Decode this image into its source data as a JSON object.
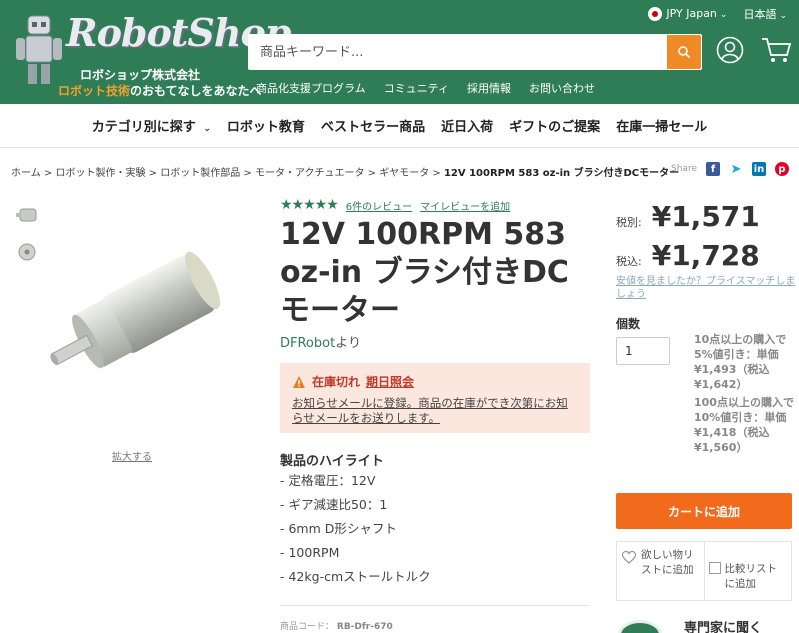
{
  "header": {
    "logo_text": "RobotShop",
    "logo_sub1": "ロボショップ株式会社",
    "logo_sub2_accent": "ロボット技術",
    "logo_sub2_rest": "のおもてなしをあなたへ",
    "currency": "JPY Japan",
    "language": "日本語",
    "search_placeholder": "商品キーワード...",
    "sublinks": [
      "商品化支援プログラム",
      "コミュニティ",
      "採用情報",
      "お問い合わせ"
    ]
  },
  "catnav": [
    "カテゴリ別に探す",
    "ロボット教育",
    "ベストセラー商品",
    "近日入荷",
    "ギフトのご提案",
    "在庫一掃セール"
  ],
  "breadcrumb": [
    "ホーム",
    "ロボット製作・実験",
    "ロボット製作部品",
    "モータ・アクチュエータ",
    "ギヤモータ"
  ],
  "breadcrumb_current": "12V 100RPM 583 oz-in ブラシ付きDCモーター",
  "share": {
    "label": "Share",
    "icons": [
      "facebook-icon",
      "twitter-icon",
      "linkedin-icon",
      "pinterest-icon"
    ]
  },
  "gallery": {
    "zoom_label": "拡大する"
  },
  "product": {
    "reviews_link": "6件のレビュー",
    "add_review_link": "マイレビューを追加",
    "rating": 4.5,
    "title": "12V 100RPM 583 oz-in ブラシ付きDCモーター",
    "brand_link": "DFRobot",
    "brand_suffix": "より",
    "stock_status": "在庫切れ",
    "stock_eta": "期日照会",
    "notify_text": "お知らせメールに登録。商品の在庫ができ次第にお知らせメールをお送りします。",
    "highlights_title": "製品のハイライト",
    "highlights": [
      "定格電圧：12V",
      "ギア減速比50：1",
      "6mm D形シャフト",
      "100RPM",
      "42kg-cmストールトルク"
    ],
    "sku_label": "商品コード：",
    "sku": "RB-Dfr-670"
  },
  "pricing": {
    "tax_excl_label": "税別:",
    "tax_excl_price": "¥1,571",
    "tax_incl_label": "税込:",
    "tax_incl_price": "¥1,728",
    "price_match": "安値を見ましたか？プライスマッチしましょう",
    "qty_label": "個数",
    "qty_value": "1",
    "discount1": "10点以上の購入で5%値引き：単価¥1,493（税込¥1,642）",
    "discount2": "100点以上の購入で10%値引き：単価¥1,418（税込¥1,560）",
    "add_to_cart": "カートに追加",
    "wishlist": "欲しい物リストに追加",
    "compare": "比較リストに追加",
    "expert": "専門家に聞く"
  },
  "colors": {
    "brand_green": "#2e7d57",
    "accent_orange": "#f26b1d",
    "alert_red": "#c0392b"
  }
}
